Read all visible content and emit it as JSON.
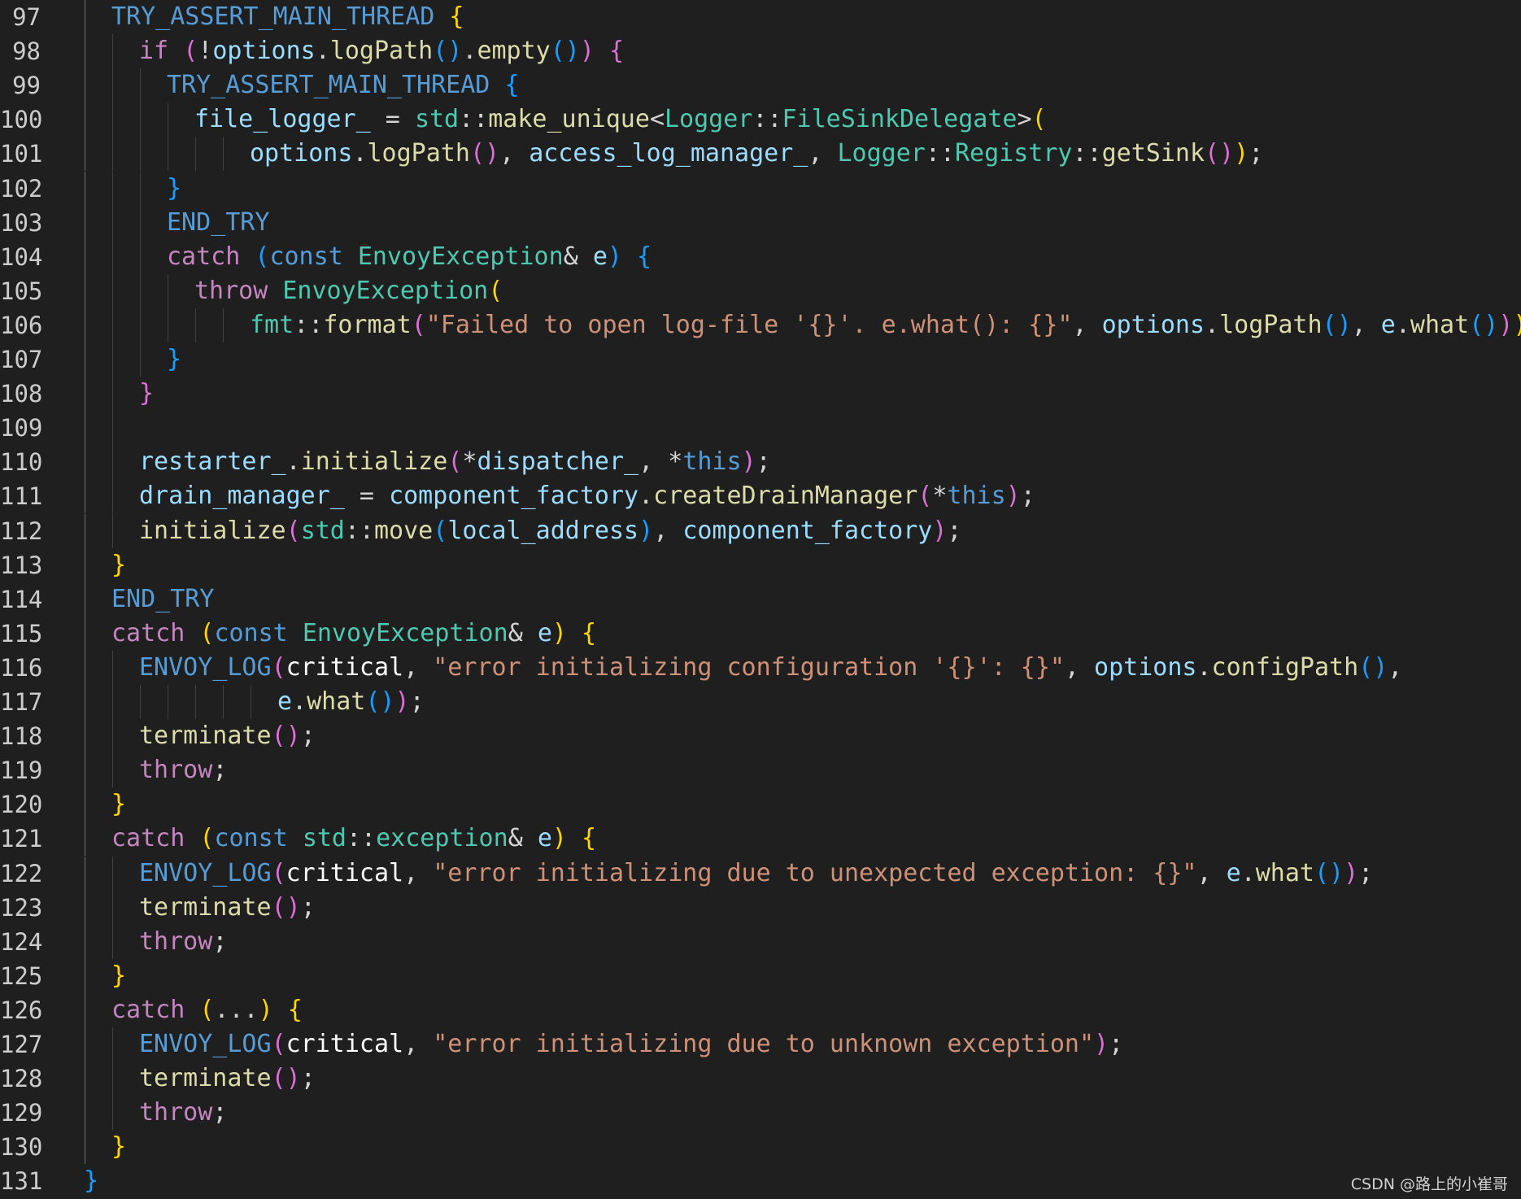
{
  "editor": {
    "first_line_number": 97,
    "colors": {
      "background": "#1f1f1f",
      "default": "#ffffff",
      "variable": "#9cdcfe",
      "macro": "#569cd6",
      "keyword_control": "#c586c0",
      "keyword": "#569cd6",
      "function": "#dcdcaa",
      "type": "#4ec9b0",
      "string": "#ce9178",
      "bracket_gold": "#ffd700",
      "bracket_purple": "#da70d6",
      "bracket_blue": "#179fff",
      "operator": "#d4d4d4"
    },
    "lines": [
      {
        "n": "97",
        "indent": 1,
        "tokens": [
          [
            "TRY_ASSERT_MAIN_THREAD",
            "macro"
          ],
          [
            " ",
            "default"
          ],
          [
            "{",
            "bracket_gold"
          ]
        ]
      },
      {
        "n": "98",
        "indent": 2,
        "tokens": [
          [
            "if",
            "keyword_control"
          ],
          [
            " ",
            "default"
          ],
          [
            "(",
            "bracket_purple"
          ],
          [
            "!",
            "operator"
          ],
          [
            "options",
            "variable"
          ],
          [
            ".",
            "operator"
          ],
          [
            "logPath",
            "function"
          ],
          [
            "()",
            "bracket_blue"
          ],
          [
            ".",
            "operator"
          ],
          [
            "empty",
            "function"
          ],
          [
            "()",
            "bracket_blue"
          ],
          [
            ")",
            "bracket_purple"
          ],
          [
            " ",
            "default"
          ],
          [
            "{",
            "bracket_purple"
          ]
        ]
      },
      {
        "n": "99",
        "indent": 3,
        "tokens": [
          [
            "TRY_ASSERT_MAIN_THREAD",
            "macro"
          ],
          [
            " ",
            "default"
          ],
          [
            "{",
            "bracket_blue"
          ]
        ]
      },
      {
        "n": "100",
        "indent": 4,
        "tokens": [
          [
            "file_logger_",
            "variable"
          ],
          [
            " = ",
            "operator"
          ],
          [
            "std",
            "type"
          ],
          [
            "::",
            "operator"
          ],
          [
            "make_unique",
            "function"
          ],
          [
            "<",
            "operator"
          ],
          [
            "Logger",
            "type"
          ],
          [
            "::",
            "operator"
          ],
          [
            "FileSinkDelegate",
            "type"
          ],
          [
            ">",
            "operator"
          ],
          [
            "(",
            "bracket_gold"
          ]
        ]
      },
      {
        "n": "101",
        "indent": 6,
        "tokens": [
          [
            "options",
            "variable"
          ],
          [
            ".",
            "operator"
          ],
          [
            "logPath",
            "function"
          ],
          [
            "()",
            "bracket_purple"
          ],
          [
            ", ",
            "operator"
          ],
          [
            "access_log_manager_",
            "variable"
          ],
          [
            ", ",
            "operator"
          ],
          [
            "Logger",
            "type"
          ],
          [
            "::",
            "operator"
          ],
          [
            "Registry",
            "type"
          ],
          [
            "::",
            "operator"
          ],
          [
            "getSink",
            "function"
          ],
          [
            "()",
            "bracket_purple"
          ],
          [
            ")",
            "bracket_gold"
          ],
          [
            ";",
            "operator"
          ]
        ]
      },
      {
        "n": "102",
        "indent": 3,
        "tokens": [
          [
            "}",
            "bracket_blue"
          ]
        ]
      },
      {
        "n": "103",
        "indent": 3,
        "tokens": [
          [
            "END_TRY",
            "macro"
          ]
        ]
      },
      {
        "n": "104",
        "indent": 3,
        "tokens": [
          [
            "catch",
            "keyword_control"
          ],
          [
            " ",
            "default"
          ],
          [
            "(",
            "bracket_blue"
          ],
          [
            "const",
            "keyword"
          ],
          [
            " ",
            "default"
          ],
          [
            "EnvoyException",
            "type"
          ],
          [
            "& ",
            "operator"
          ],
          [
            "e",
            "variable"
          ],
          [
            ")",
            "bracket_blue"
          ],
          [
            " ",
            "default"
          ],
          [
            "{",
            "bracket_blue"
          ]
        ]
      },
      {
        "n": "105",
        "indent": 4,
        "tokens": [
          [
            "throw",
            "keyword_control"
          ],
          [
            " ",
            "default"
          ],
          [
            "EnvoyException",
            "type"
          ],
          [
            "(",
            "bracket_gold"
          ]
        ]
      },
      {
        "n": "106",
        "indent": 6,
        "tokens": [
          [
            "fmt",
            "type"
          ],
          [
            "::",
            "operator"
          ],
          [
            "format",
            "function"
          ],
          [
            "(",
            "bracket_purple"
          ],
          [
            "\"Failed to open log-file '{}'. e.what(): {}\"",
            "string"
          ],
          [
            ", ",
            "operator"
          ],
          [
            "options",
            "variable"
          ],
          [
            ".",
            "operator"
          ],
          [
            "logPath",
            "function"
          ],
          [
            "()",
            "bracket_blue"
          ],
          [
            ", ",
            "operator"
          ],
          [
            "e",
            "variable"
          ],
          [
            ".",
            "operator"
          ],
          [
            "what",
            "function"
          ],
          [
            "()",
            "bracket_blue"
          ],
          [
            ")",
            "bracket_purple"
          ],
          [
            ")",
            "bracket_gold"
          ],
          [
            ";",
            "operator"
          ]
        ]
      },
      {
        "n": "107",
        "indent": 3,
        "tokens": [
          [
            "}",
            "bracket_blue"
          ]
        ]
      },
      {
        "n": "108",
        "indent": 2,
        "tokens": [
          [
            "}",
            "bracket_purple"
          ]
        ]
      },
      {
        "n": "109",
        "indent": 2,
        "tokens": []
      },
      {
        "n": "110",
        "indent": 2,
        "tokens": [
          [
            "restarter_",
            "variable"
          ],
          [
            ".",
            "operator"
          ],
          [
            "initialize",
            "function"
          ],
          [
            "(",
            "bracket_purple"
          ],
          [
            "*",
            "operator"
          ],
          [
            "dispatcher_",
            "variable"
          ],
          [
            ", ",
            "operator"
          ],
          [
            "*",
            "operator"
          ],
          [
            "this",
            "keyword"
          ],
          [
            ")",
            "bracket_purple"
          ],
          [
            ";",
            "operator"
          ]
        ]
      },
      {
        "n": "111",
        "indent": 2,
        "tokens": [
          [
            "drain_manager_",
            "variable"
          ],
          [
            " = ",
            "operator"
          ],
          [
            "component_factory",
            "variable"
          ],
          [
            ".",
            "operator"
          ],
          [
            "createDrainManager",
            "function"
          ],
          [
            "(",
            "bracket_purple"
          ],
          [
            "*",
            "operator"
          ],
          [
            "this",
            "keyword"
          ],
          [
            ")",
            "bracket_purple"
          ],
          [
            ";",
            "operator"
          ]
        ]
      },
      {
        "n": "112",
        "indent": 2,
        "tokens": [
          [
            "initialize",
            "function"
          ],
          [
            "(",
            "bracket_purple"
          ],
          [
            "std",
            "type"
          ],
          [
            "::",
            "operator"
          ],
          [
            "move",
            "function"
          ],
          [
            "(",
            "bracket_blue"
          ],
          [
            "local_address",
            "variable"
          ],
          [
            ")",
            "bracket_blue"
          ],
          [
            ", ",
            "operator"
          ],
          [
            "component_factory",
            "variable"
          ],
          [
            ")",
            "bracket_purple"
          ],
          [
            ";",
            "operator"
          ]
        ]
      },
      {
        "n": "113",
        "indent": 1,
        "tokens": [
          [
            "}",
            "bracket_gold"
          ]
        ]
      },
      {
        "n": "114",
        "indent": 1,
        "tokens": [
          [
            "END_TRY",
            "macro"
          ]
        ]
      },
      {
        "n": "115",
        "indent": 1,
        "tokens": [
          [
            "catch",
            "keyword_control"
          ],
          [
            " ",
            "default"
          ],
          [
            "(",
            "bracket_gold"
          ],
          [
            "const",
            "keyword"
          ],
          [
            " ",
            "default"
          ],
          [
            "EnvoyException",
            "type"
          ],
          [
            "& ",
            "operator"
          ],
          [
            "e",
            "variable"
          ],
          [
            ")",
            "bracket_gold"
          ],
          [
            " ",
            "default"
          ],
          [
            "{",
            "bracket_gold"
          ]
        ]
      },
      {
        "n": "116",
        "indent": 2,
        "tokens": [
          [
            "ENVOY_LOG",
            "macro"
          ],
          [
            "(",
            "bracket_purple"
          ],
          [
            "critical",
            "default"
          ],
          [
            ", ",
            "operator"
          ],
          [
            "\"error initializing configuration '{}': {}\"",
            "string"
          ],
          [
            ", ",
            "operator"
          ],
          [
            "options",
            "variable"
          ],
          [
            ".",
            "operator"
          ],
          [
            "configPath",
            "function"
          ],
          [
            "()",
            "bracket_blue"
          ],
          [
            ",",
            "operator"
          ]
        ]
      },
      {
        "n": "117",
        "indent": 7,
        "tokens": [
          [
            "e",
            "variable"
          ],
          [
            ".",
            "operator"
          ],
          [
            "what",
            "function"
          ],
          [
            "()",
            "bracket_blue"
          ],
          [
            ")",
            "bracket_purple"
          ],
          [
            ";",
            "operator"
          ]
        ]
      },
      {
        "n": "118",
        "indent": 2,
        "tokens": [
          [
            "terminate",
            "function"
          ],
          [
            "()",
            "bracket_purple"
          ],
          [
            ";",
            "operator"
          ]
        ]
      },
      {
        "n": "119",
        "indent": 2,
        "tokens": [
          [
            "throw",
            "keyword_control"
          ],
          [
            ";",
            "operator"
          ]
        ]
      },
      {
        "n": "120",
        "indent": 1,
        "tokens": [
          [
            "}",
            "bracket_gold"
          ]
        ]
      },
      {
        "n": "121",
        "indent": 1,
        "tokens": [
          [
            "catch",
            "keyword_control"
          ],
          [
            " ",
            "default"
          ],
          [
            "(",
            "bracket_gold"
          ],
          [
            "const",
            "keyword"
          ],
          [
            " ",
            "default"
          ],
          [
            "std",
            "type"
          ],
          [
            "::",
            "operator"
          ],
          [
            "exception",
            "type"
          ],
          [
            "& ",
            "operator"
          ],
          [
            "e",
            "variable"
          ],
          [
            ")",
            "bracket_gold"
          ],
          [
            " ",
            "default"
          ],
          [
            "{",
            "bracket_gold"
          ]
        ]
      },
      {
        "n": "122",
        "indent": 2,
        "tokens": [
          [
            "ENVOY_LOG",
            "macro"
          ],
          [
            "(",
            "bracket_purple"
          ],
          [
            "critical",
            "default"
          ],
          [
            ", ",
            "operator"
          ],
          [
            "\"error initializing due to unexpected exception: {}\"",
            "string"
          ],
          [
            ", ",
            "operator"
          ],
          [
            "e",
            "variable"
          ],
          [
            ".",
            "operator"
          ],
          [
            "what",
            "function"
          ],
          [
            "()",
            "bracket_blue"
          ],
          [
            ")",
            "bracket_purple"
          ],
          [
            ";",
            "operator"
          ]
        ]
      },
      {
        "n": "123",
        "indent": 2,
        "tokens": [
          [
            "terminate",
            "function"
          ],
          [
            "()",
            "bracket_purple"
          ],
          [
            ";",
            "operator"
          ]
        ]
      },
      {
        "n": "124",
        "indent": 2,
        "tokens": [
          [
            "throw",
            "keyword_control"
          ],
          [
            ";",
            "operator"
          ]
        ]
      },
      {
        "n": "125",
        "indent": 1,
        "tokens": [
          [
            "}",
            "bracket_gold"
          ]
        ]
      },
      {
        "n": "126",
        "indent": 1,
        "tokens": [
          [
            "catch",
            "keyword_control"
          ],
          [
            " ",
            "default"
          ],
          [
            "(",
            "bracket_gold"
          ],
          [
            "...",
            "operator"
          ],
          [
            ")",
            "bracket_gold"
          ],
          [
            " ",
            "default"
          ],
          [
            "{",
            "bracket_gold"
          ]
        ]
      },
      {
        "n": "127",
        "indent": 2,
        "tokens": [
          [
            "ENVOY_LOG",
            "macro"
          ],
          [
            "(",
            "bracket_purple"
          ],
          [
            "critical",
            "default"
          ],
          [
            ", ",
            "operator"
          ],
          [
            "\"error initializing due to unknown exception\"",
            "string"
          ],
          [
            ")",
            "bracket_purple"
          ],
          [
            ";",
            "operator"
          ]
        ]
      },
      {
        "n": "128",
        "indent": 2,
        "tokens": [
          [
            "terminate",
            "function"
          ],
          [
            "()",
            "bracket_purple"
          ],
          [
            ";",
            "operator"
          ]
        ]
      },
      {
        "n": "129",
        "indent": 2,
        "tokens": [
          [
            "throw",
            "keyword_control"
          ],
          [
            ";",
            "operator"
          ]
        ]
      },
      {
        "n": "130",
        "indent": 1,
        "tokens": [
          [
            "}",
            "bracket_gold"
          ]
        ]
      },
      {
        "n": "131",
        "indent": 0,
        "tokens": [
          [
            "}",
            "bracket_blue"
          ]
        ]
      }
    ]
  },
  "watermark": "CSDN @路上的小崔哥"
}
